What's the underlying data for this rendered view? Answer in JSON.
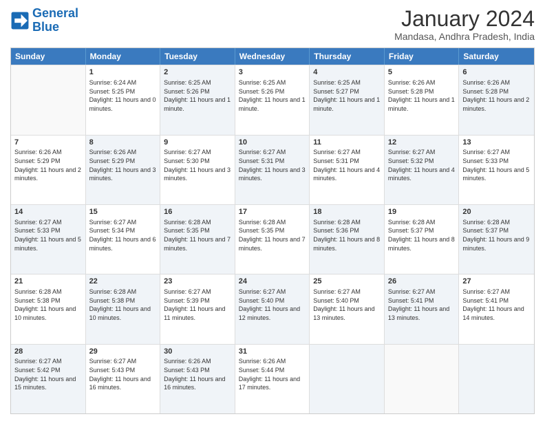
{
  "header": {
    "logo_general": "General",
    "logo_blue": "Blue",
    "month_title": "January 2024",
    "location": "Mandasa, Andhra Pradesh, India"
  },
  "days_of_week": [
    "Sunday",
    "Monday",
    "Tuesday",
    "Wednesday",
    "Thursday",
    "Friday",
    "Saturday"
  ],
  "weeks": [
    [
      {
        "day": "",
        "sunrise": "",
        "sunset": "",
        "daylight": "",
        "shaded": false
      },
      {
        "day": "1",
        "sunrise": "Sunrise: 6:24 AM",
        "sunset": "Sunset: 5:25 PM",
        "daylight": "Daylight: 11 hours and 0 minutes.",
        "shaded": false
      },
      {
        "day": "2",
        "sunrise": "Sunrise: 6:25 AM",
        "sunset": "Sunset: 5:26 PM",
        "daylight": "Daylight: 11 hours and 1 minute.",
        "shaded": true
      },
      {
        "day": "3",
        "sunrise": "Sunrise: 6:25 AM",
        "sunset": "Sunset: 5:26 PM",
        "daylight": "Daylight: 11 hours and 1 minute.",
        "shaded": false
      },
      {
        "day": "4",
        "sunrise": "Sunrise: 6:25 AM",
        "sunset": "Sunset: 5:27 PM",
        "daylight": "Daylight: 11 hours and 1 minute.",
        "shaded": true
      },
      {
        "day": "5",
        "sunrise": "Sunrise: 6:26 AM",
        "sunset": "Sunset: 5:28 PM",
        "daylight": "Daylight: 11 hours and 1 minute.",
        "shaded": false
      },
      {
        "day": "6",
        "sunrise": "Sunrise: 6:26 AM",
        "sunset": "Sunset: 5:28 PM",
        "daylight": "Daylight: 11 hours and 2 minutes.",
        "shaded": true
      }
    ],
    [
      {
        "day": "7",
        "sunrise": "Sunrise: 6:26 AM",
        "sunset": "Sunset: 5:29 PM",
        "daylight": "Daylight: 11 hours and 2 minutes.",
        "shaded": false
      },
      {
        "day": "8",
        "sunrise": "Sunrise: 6:26 AM",
        "sunset": "Sunset: 5:29 PM",
        "daylight": "Daylight: 11 hours and 3 minutes.",
        "shaded": true
      },
      {
        "day": "9",
        "sunrise": "Sunrise: 6:27 AM",
        "sunset": "Sunset: 5:30 PM",
        "daylight": "Daylight: 11 hours and 3 minutes.",
        "shaded": false
      },
      {
        "day": "10",
        "sunrise": "Sunrise: 6:27 AM",
        "sunset": "Sunset: 5:31 PM",
        "daylight": "Daylight: 11 hours and 3 minutes.",
        "shaded": true
      },
      {
        "day": "11",
        "sunrise": "Sunrise: 6:27 AM",
        "sunset": "Sunset: 5:31 PM",
        "daylight": "Daylight: 11 hours and 4 minutes.",
        "shaded": false
      },
      {
        "day": "12",
        "sunrise": "Sunrise: 6:27 AM",
        "sunset": "Sunset: 5:32 PM",
        "daylight": "Daylight: 11 hours and 4 minutes.",
        "shaded": true
      },
      {
        "day": "13",
        "sunrise": "Sunrise: 6:27 AM",
        "sunset": "Sunset: 5:33 PM",
        "daylight": "Daylight: 11 hours and 5 minutes.",
        "shaded": false
      }
    ],
    [
      {
        "day": "14",
        "sunrise": "Sunrise: 6:27 AM",
        "sunset": "Sunset: 5:33 PM",
        "daylight": "Daylight: 11 hours and 5 minutes.",
        "shaded": true
      },
      {
        "day": "15",
        "sunrise": "Sunrise: 6:27 AM",
        "sunset": "Sunset: 5:34 PM",
        "daylight": "Daylight: 11 hours and 6 minutes.",
        "shaded": false
      },
      {
        "day": "16",
        "sunrise": "Sunrise: 6:28 AM",
        "sunset": "Sunset: 5:35 PM",
        "daylight": "Daylight: 11 hours and 7 minutes.",
        "shaded": true
      },
      {
        "day": "17",
        "sunrise": "Sunrise: 6:28 AM",
        "sunset": "Sunset: 5:35 PM",
        "daylight": "Daylight: 11 hours and 7 minutes.",
        "shaded": false
      },
      {
        "day": "18",
        "sunrise": "Sunrise: 6:28 AM",
        "sunset": "Sunset: 5:36 PM",
        "daylight": "Daylight: 11 hours and 8 minutes.",
        "shaded": true
      },
      {
        "day": "19",
        "sunrise": "Sunrise: 6:28 AM",
        "sunset": "Sunset: 5:37 PM",
        "daylight": "Daylight: 11 hours and 8 minutes.",
        "shaded": false
      },
      {
        "day": "20",
        "sunrise": "Sunrise: 6:28 AM",
        "sunset": "Sunset: 5:37 PM",
        "daylight": "Daylight: 11 hours and 9 minutes.",
        "shaded": true
      }
    ],
    [
      {
        "day": "21",
        "sunrise": "Sunrise: 6:28 AM",
        "sunset": "Sunset: 5:38 PM",
        "daylight": "Daylight: 11 hours and 10 minutes.",
        "shaded": false
      },
      {
        "day": "22",
        "sunrise": "Sunrise: 6:28 AM",
        "sunset": "Sunset: 5:38 PM",
        "daylight": "Daylight: 11 hours and 10 minutes.",
        "shaded": true
      },
      {
        "day": "23",
        "sunrise": "Sunrise: 6:27 AM",
        "sunset": "Sunset: 5:39 PM",
        "daylight": "Daylight: 11 hours and 11 minutes.",
        "shaded": false
      },
      {
        "day": "24",
        "sunrise": "Sunrise: 6:27 AM",
        "sunset": "Sunset: 5:40 PM",
        "daylight": "Daylight: 11 hours and 12 minutes.",
        "shaded": true
      },
      {
        "day": "25",
        "sunrise": "Sunrise: 6:27 AM",
        "sunset": "Sunset: 5:40 PM",
        "daylight": "Daylight: 11 hours and 13 minutes.",
        "shaded": false
      },
      {
        "day": "26",
        "sunrise": "Sunrise: 6:27 AM",
        "sunset": "Sunset: 5:41 PM",
        "daylight": "Daylight: 11 hours and 13 minutes.",
        "shaded": true
      },
      {
        "day": "27",
        "sunrise": "Sunrise: 6:27 AM",
        "sunset": "Sunset: 5:41 PM",
        "daylight": "Daylight: 11 hours and 14 minutes.",
        "shaded": false
      }
    ],
    [
      {
        "day": "28",
        "sunrise": "Sunrise: 6:27 AM",
        "sunset": "Sunset: 5:42 PM",
        "daylight": "Daylight: 11 hours and 15 minutes.",
        "shaded": true
      },
      {
        "day": "29",
        "sunrise": "Sunrise: 6:27 AM",
        "sunset": "Sunset: 5:43 PM",
        "daylight": "Daylight: 11 hours and 16 minutes.",
        "shaded": false
      },
      {
        "day": "30",
        "sunrise": "Sunrise: 6:26 AM",
        "sunset": "Sunset: 5:43 PM",
        "daylight": "Daylight: 11 hours and 16 minutes.",
        "shaded": true
      },
      {
        "day": "31",
        "sunrise": "Sunrise: 6:26 AM",
        "sunset": "Sunset: 5:44 PM",
        "daylight": "Daylight: 11 hours and 17 minutes.",
        "shaded": false
      },
      {
        "day": "",
        "sunrise": "",
        "sunset": "",
        "daylight": "",
        "shaded": true
      },
      {
        "day": "",
        "sunrise": "",
        "sunset": "",
        "daylight": "",
        "shaded": false
      },
      {
        "day": "",
        "sunrise": "",
        "sunset": "",
        "daylight": "",
        "shaded": true
      }
    ]
  ]
}
